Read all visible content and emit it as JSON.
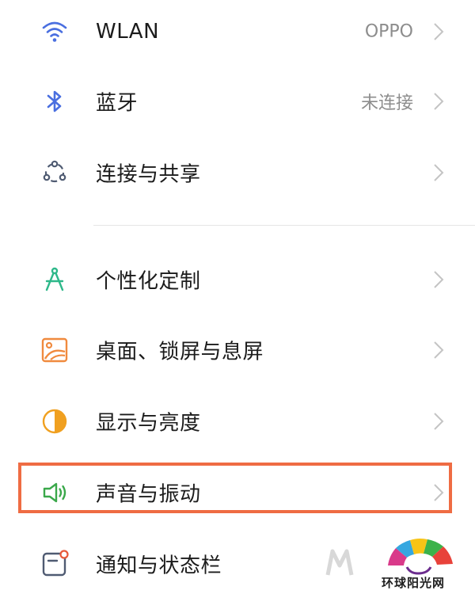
{
  "settings": {
    "items": [
      {
        "label": "WLAN",
        "value": "OPPO",
        "icon": "wifi-icon"
      },
      {
        "label": "蓝牙",
        "value": "未连接",
        "icon": "bluetooth-icon"
      },
      {
        "label": "连接与共享",
        "value": "",
        "icon": "share-icon"
      },
      {
        "label": "个性化定制",
        "value": "",
        "icon": "compass-icon"
      },
      {
        "label": "桌面、锁屏与息屏",
        "value": "",
        "icon": "wallpaper-icon"
      },
      {
        "label": "显示与亮度",
        "value": "",
        "icon": "brightness-icon"
      },
      {
        "label": "声音与振动",
        "value": "",
        "icon": "speaker-icon"
      },
      {
        "label": "通知与状态栏",
        "value": "",
        "icon": "notification-icon"
      }
    ]
  },
  "watermark": {
    "text": "环球阳光网"
  },
  "colors": {
    "wifi": "#4a6fe0",
    "bluetooth": "#4a6fe0",
    "share": "#4f5b72",
    "compass": "#2eb88a",
    "wallpaper": "#f08a3e",
    "brightness": "#f0a020",
    "speaker": "#3aa84a",
    "notification": "#4f5b72",
    "highlight": "#ef6c43"
  }
}
